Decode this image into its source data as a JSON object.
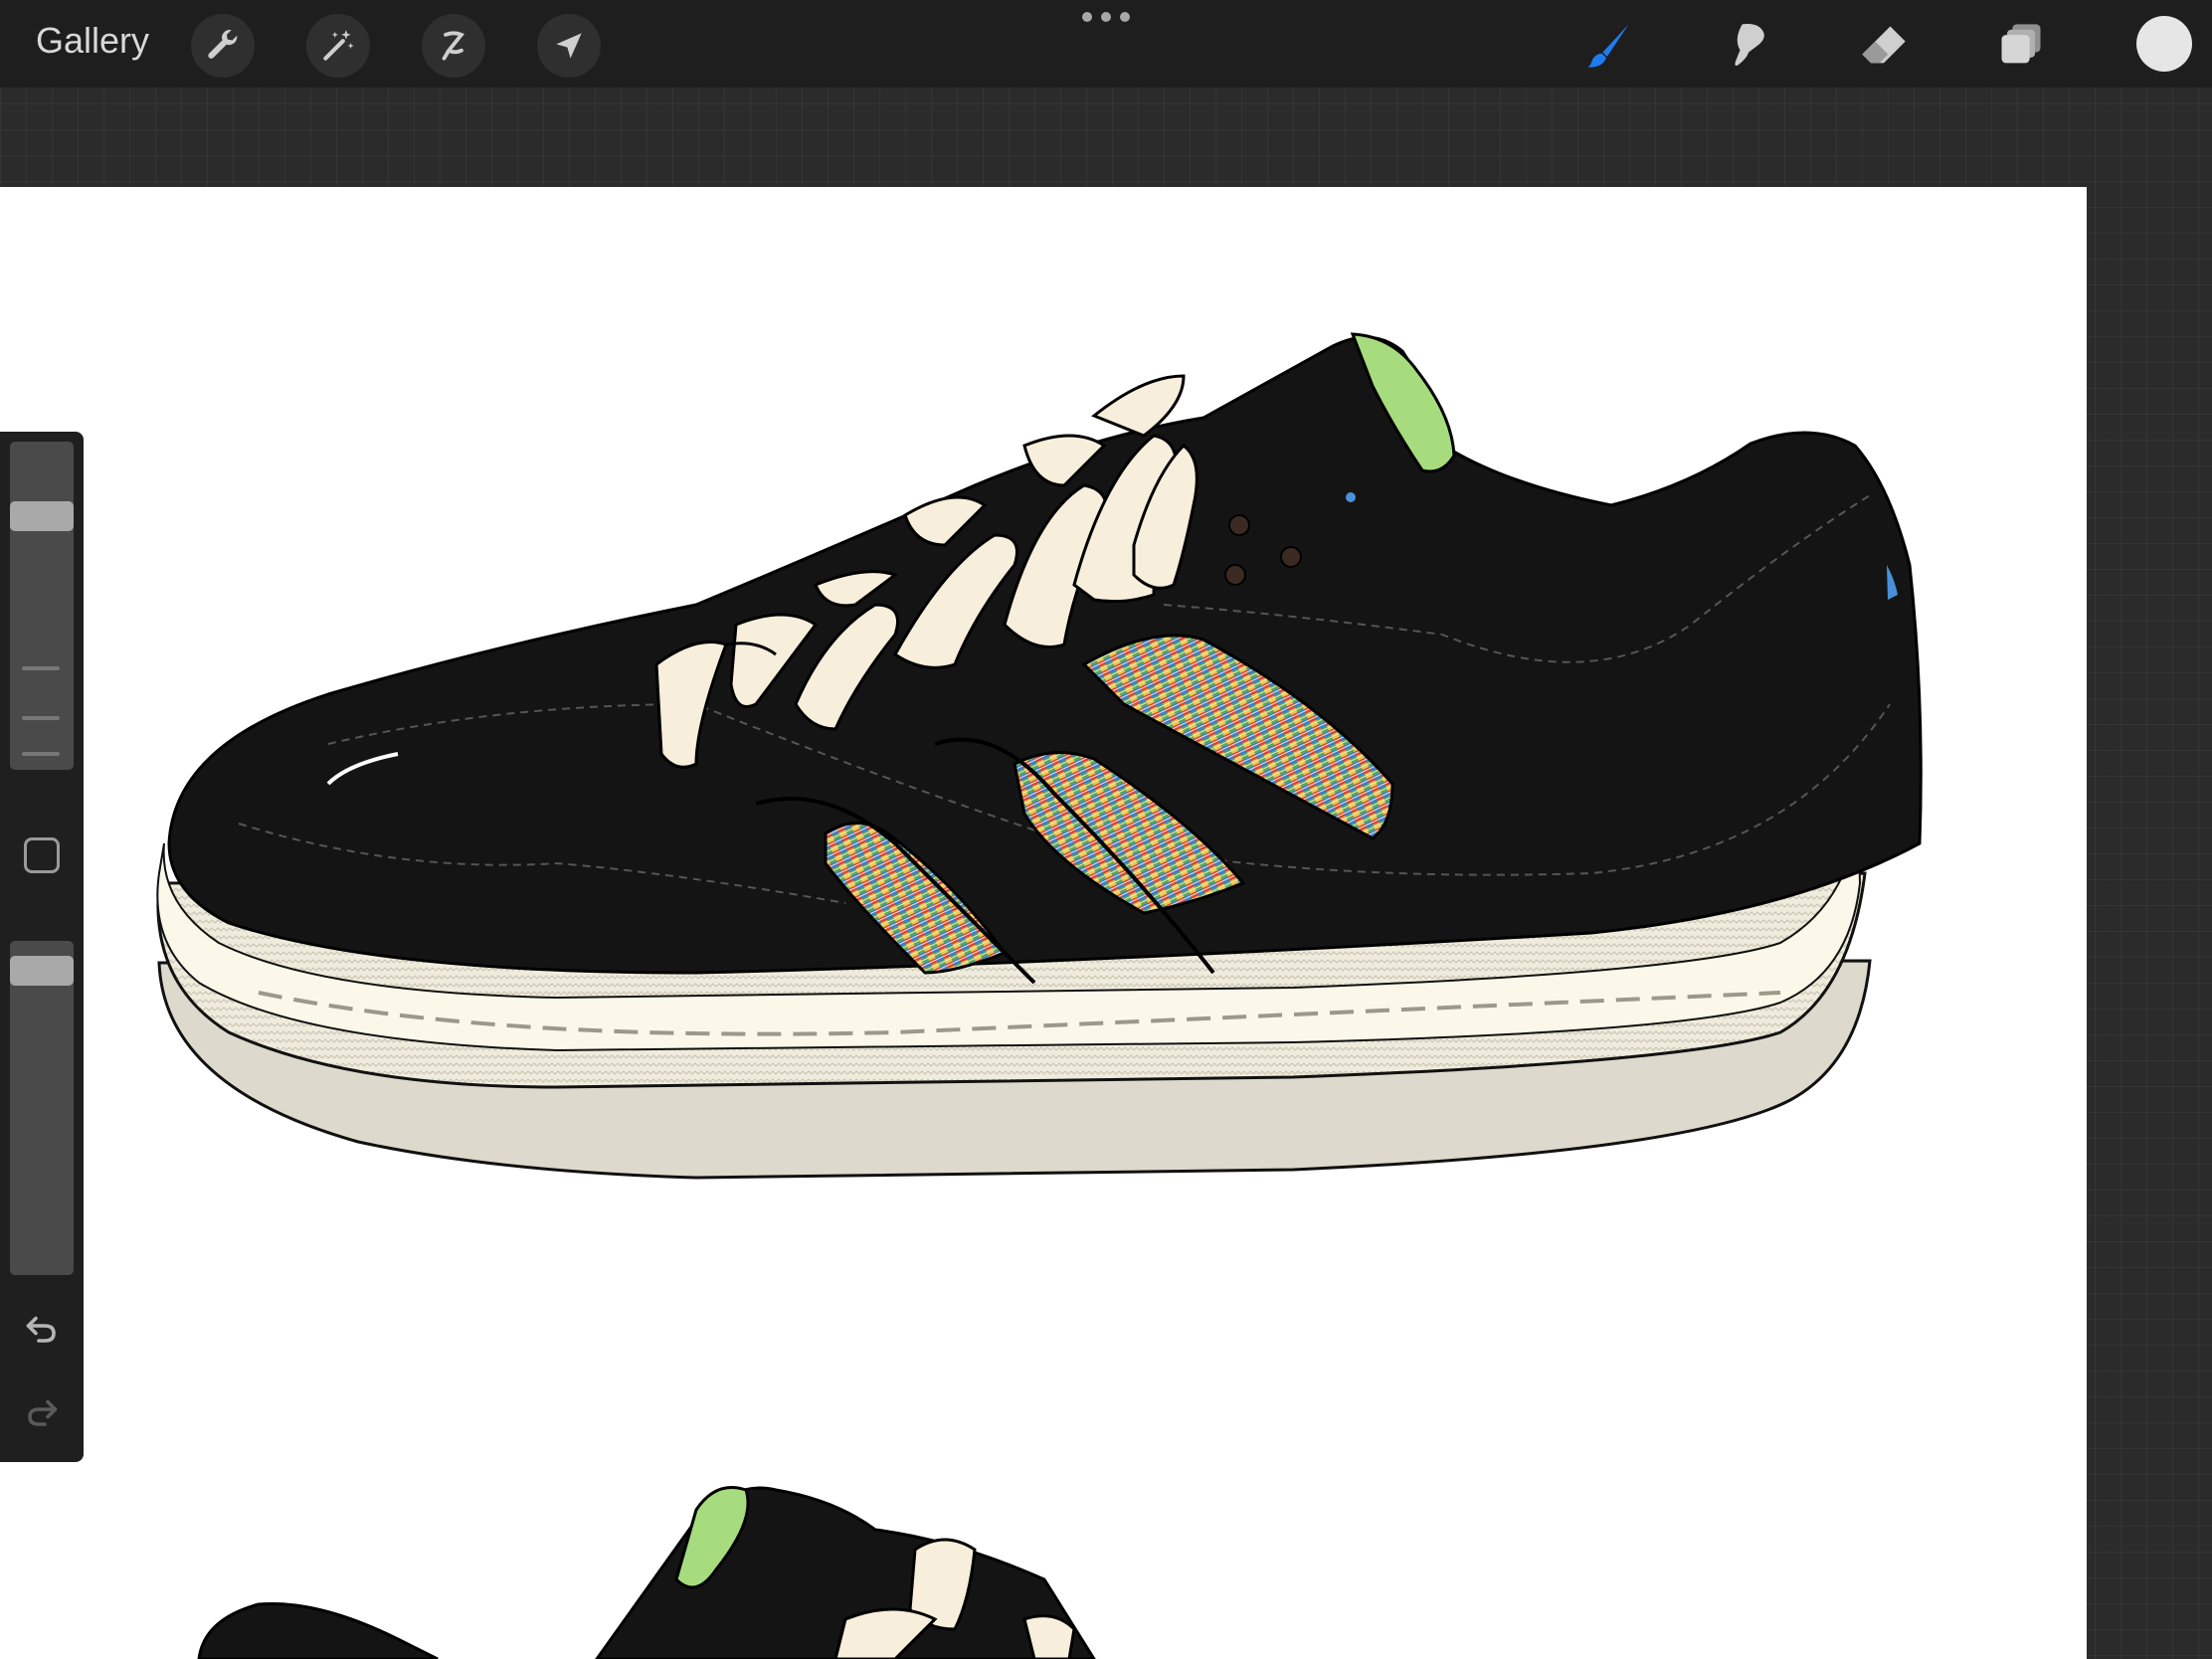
{
  "toolbar": {
    "gallery_label": "Gallery",
    "left_tools": [
      "wrench-icon",
      "magic-wand-icon",
      "selection-icon",
      "transform-arrow-icon"
    ],
    "right_tools": [
      "brush-icon",
      "smudge-icon",
      "eraser-icon",
      "layers-icon"
    ],
    "active_tool": "brush",
    "accent_color": "#1e7cf2",
    "current_color": "#e6e6e6"
  },
  "sidebar": {
    "brush_size": 0.8,
    "brush_opacity": 0.95,
    "modify_button": "square-icon",
    "undo": "undo-icon",
    "redo": "redo-icon"
  },
  "canvas": {
    "background": "#ffffff",
    "content": "sneaker-illustration"
  },
  "colors": {
    "toolbar_bg": "#1e1e1e",
    "workspace_bg": "#2b2b2b",
    "shoe_upper": "#141414",
    "laces": "#f7eedb",
    "collar_accent": "#a6dc7e",
    "sole": "#fbf8ea",
    "heel_tab": "#4a90d9"
  }
}
